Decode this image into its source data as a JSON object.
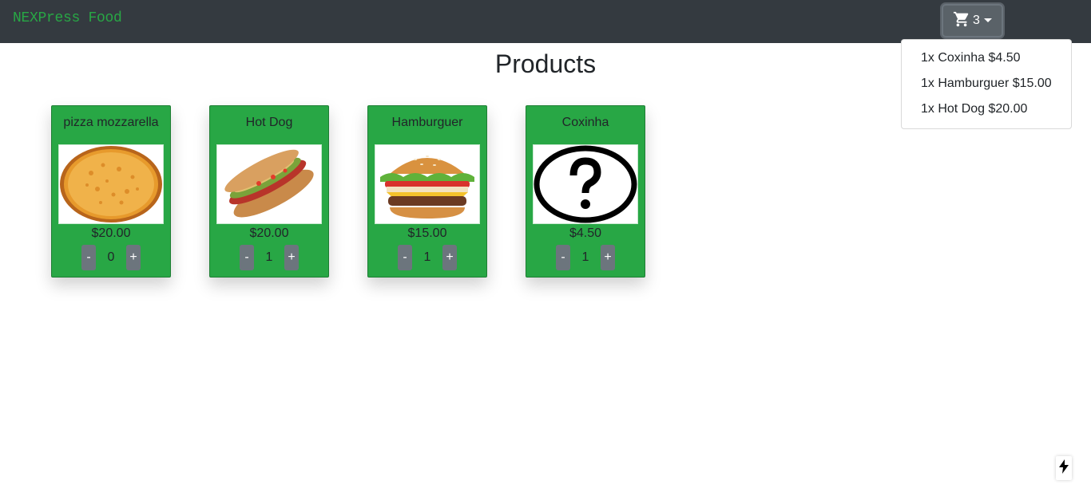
{
  "app": {
    "brand": "NEXPress Food",
    "accent_color": "#28a745",
    "navbar_color": "#343a40"
  },
  "cart": {
    "icon": "cart-icon",
    "count": "3",
    "items": [
      {
        "label": "1x Coxinha $4.50"
      },
      {
        "label": "1x Hamburguer $15.00"
      },
      {
        "label": "1x Hot Dog $20.00"
      }
    ]
  },
  "page": {
    "title": "Products"
  },
  "products": [
    {
      "name": "pizza mozzarella",
      "price": "$20.00",
      "quantity": "0",
      "image": "pizza-image",
      "minus": "-",
      "plus": "+"
    },
    {
      "name": "Hot Dog",
      "price": "$20.00",
      "quantity": "1",
      "image": "hot-dog-image",
      "minus": "-",
      "plus": "+"
    },
    {
      "name": "Hamburguer",
      "price": "$15.00",
      "quantity": "1",
      "image": "hamburger-image",
      "minus": "-",
      "plus": "+"
    },
    {
      "name": "Coxinha",
      "price": "$4.50",
      "quantity": "1",
      "image": "question-mark-placeholder",
      "minus": "-",
      "plus": "+"
    }
  ],
  "floating": {
    "icon": "lightning-bolt-icon"
  }
}
